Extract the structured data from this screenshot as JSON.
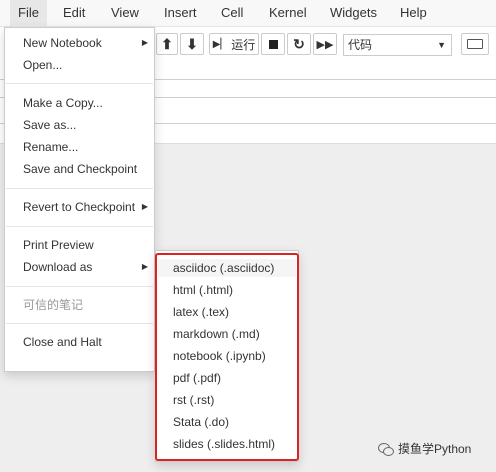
{
  "menubar": {
    "items": [
      "File",
      "Edit",
      "View",
      "Insert",
      "Cell",
      "Kernel",
      "Widgets",
      "Help"
    ]
  },
  "toolbar": {
    "run_label": "运行",
    "cell_type_value": "代码"
  },
  "file_menu": {
    "items": [
      {
        "label": "New Notebook"
      },
      {
        "label": "Open..."
      },
      {
        "label": "Make a Copy..."
      },
      {
        "label": "Save as..."
      },
      {
        "label": "Rename..."
      },
      {
        "label": "Save and Checkpoint"
      },
      {
        "label": "Revert to Checkpoint"
      },
      {
        "label": "Print Preview"
      },
      {
        "label": "Download as"
      },
      {
        "label": "可信的笔记"
      },
      {
        "label": "Close and Halt"
      }
    ]
  },
  "download_menu": {
    "items": [
      "asciidoc (.asciidoc)",
      "html (.html)",
      "latex (.tex)",
      "markdown (.md)",
      "notebook (.ipynb)",
      "pdf (.pdf)",
      "rst (.rst)",
      "Stata (.do)",
      "slides (.slides.html)"
    ]
  },
  "watermark": {
    "text": "摸鱼学Python"
  },
  "colors": {
    "highlight_border": "#dd2222",
    "menubar_bg": "#f8f8f8"
  }
}
